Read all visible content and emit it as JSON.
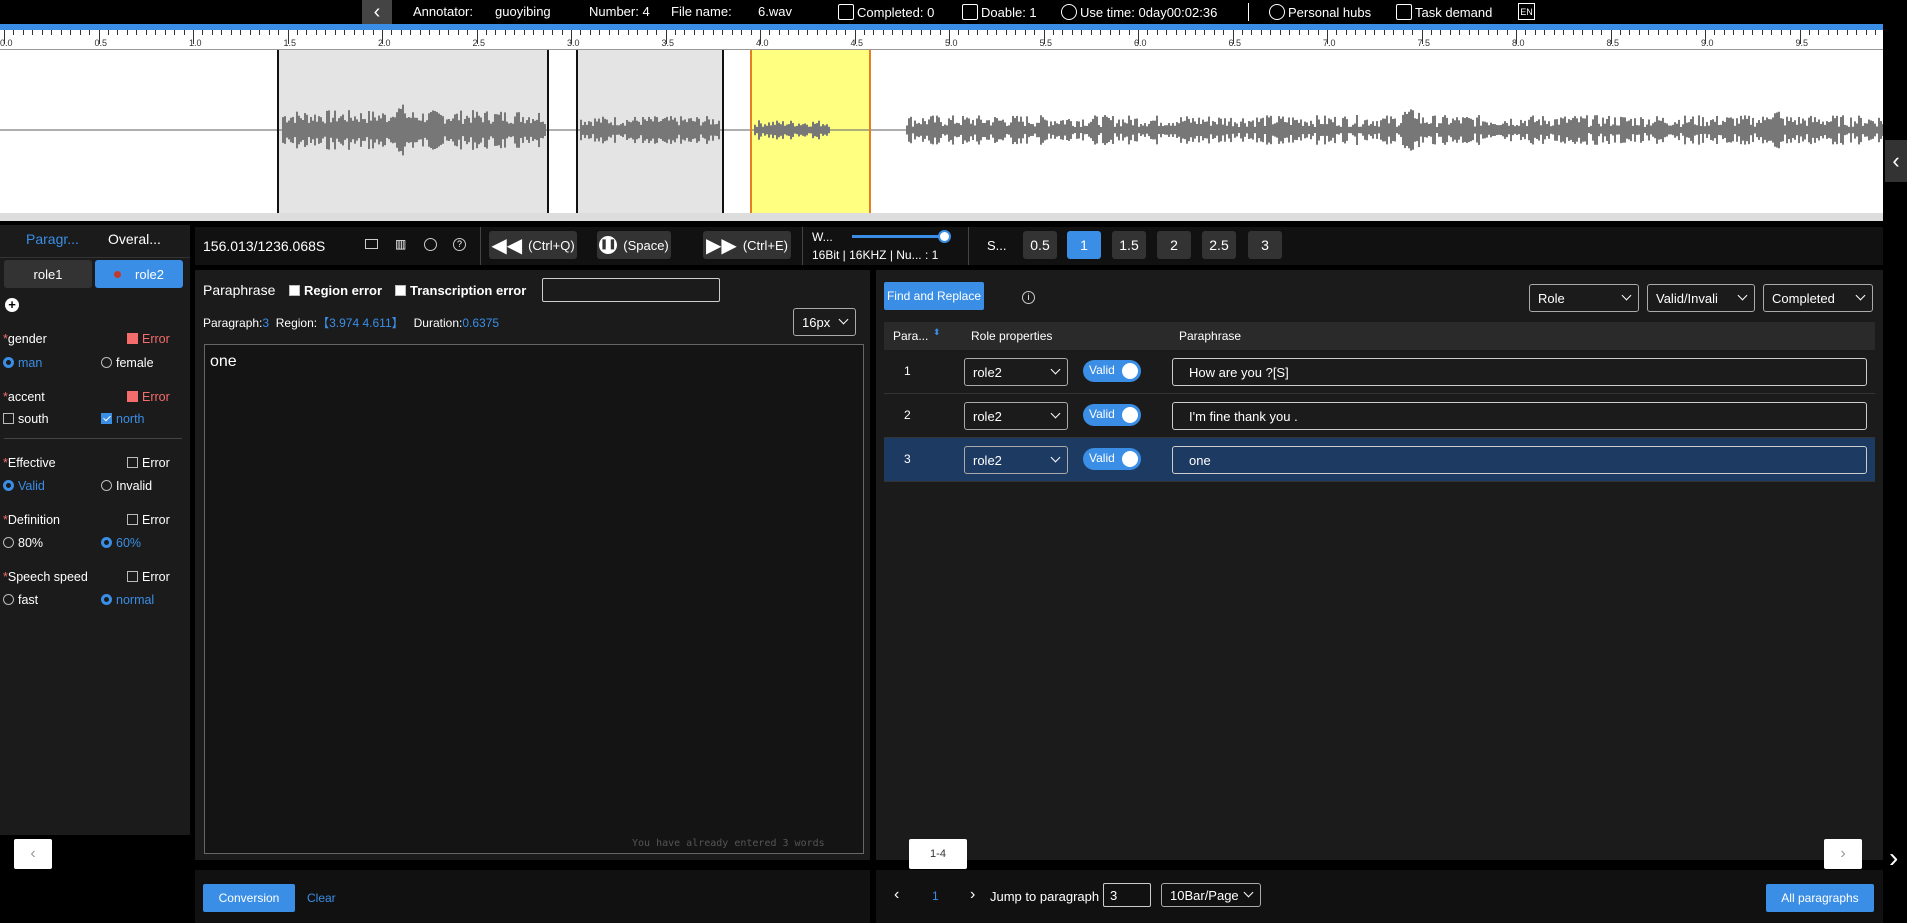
{
  "header": {
    "annotator_label": "Annotator:",
    "annotator": "guoyibing",
    "number_label": "Number: 4",
    "filename_label": "File name:",
    "filename": "6.wav",
    "completed": "Completed: 0",
    "doable": "Doable: 1",
    "usetime": "Use time:  0day00:02:36",
    "personal_hubs": "Personal hubs",
    "task_demand": "Task demand",
    "lang": "EN"
  },
  "ruler": {
    "ticks": [
      "0.0",
      "0.5",
      "1.0",
      "1.5",
      "2.0",
      "2.5",
      "3.0",
      "3.5",
      "4.0",
      "4.5",
      "5.0",
      "5.5",
      "6.0",
      "6.5",
      "7.0",
      "7.5",
      "8.0",
      "8.5",
      "9.0",
      "9.5"
    ]
  },
  "left_panel": {
    "tabs": [
      "Paragr...",
      "Overal..."
    ],
    "roles": [
      "role1",
      "role2"
    ],
    "add_icon": "plus-circle-icon",
    "error_label": "Error",
    "attributes": [
      {
        "name": "gender",
        "options": [
          "man",
          "female"
        ],
        "selected": 0,
        "error": true
      },
      {
        "name": "accent",
        "options": [
          "south",
          "north"
        ],
        "selected": 1,
        "error": true,
        "checkbox": true
      },
      {
        "name": "Effective",
        "options": [
          "Valid",
          "Invalid"
        ],
        "selected": 0,
        "error": false
      },
      {
        "name": "Definition",
        "options": [
          "80%",
          "60%"
        ],
        "selected": 1,
        "error": false
      },
      {
        "name": "Speech speed",
        "options": [
          "fast",
          "normal"
        ],
        "selected": 1,
        "error": false
      }
    ]
  },
  "controls": {
    "time": "156.013/1236.068S",
    "rewind": "(Ctrl+Q)",
    "play": "(Space)",
    "forward": "(Ctrl+E)",
    "w_label": "W...",
    "audio_info": "16Bit | 16KHZ | Nu... : 1",
    "speed_label": "S...",
    "speeds": [
      "0.5",
      "1",
      "1.5",
      "2",
      "2.5",
      "3"
    ],
    "speed_selected": 1
  },
  "editor": {
    "title": "Paraphrase",
    "region_error": "Region error",
    "transcription_error": "Transcription error",
    "paragraph_label": "Paragraph:",
    "paragraph": "3",
    "region_label": "Region:",
    "region": "【3.974   4.611】",
    "duration_label": "Duration:",
    "duration": "0.6375",
    "font_size": "16px",
    "text": "one",
    "word_count": "You have already entered 3 words",
    "conversion": "Conversion",
    "clear": "Clear"
  },
  "table": {
    "find_replace": "Find and Replace",
    "filters": [
      "Role",
      "Valid/Invali",
      "Completed"
    ],
    "headers": [
      "Para...",
      "Role properties",
      "Paraphrase"
    ],
    "rows": [
      {
        "num": "1",
        "role": "role2",
        "valid": "Valid",
        "text": "How are you ?[S]"
      },
      {
        "num": "2",
        "role": "role2",
        "valid": "Valid",
        "text": "I'm fine thank  you ."
      },
      {
        "num": "3",
        "role": "role2",
        "valid": "Valid",
        "text": "one"
      }
    ],
    "pager_tab": "1-4"
  },
  "pagination": {
    "page": "1",
    "jump_label": "Jump to paragraph",
    "jump_value": "3",
    "per_page": "10Bar/Page",
    "all": "All paragraphs"
  },
  "colors": {
    "accent": "#3a8ee6",
    "error": "#f56c6c",
    "highlight": "#ffff80"
  }
}
